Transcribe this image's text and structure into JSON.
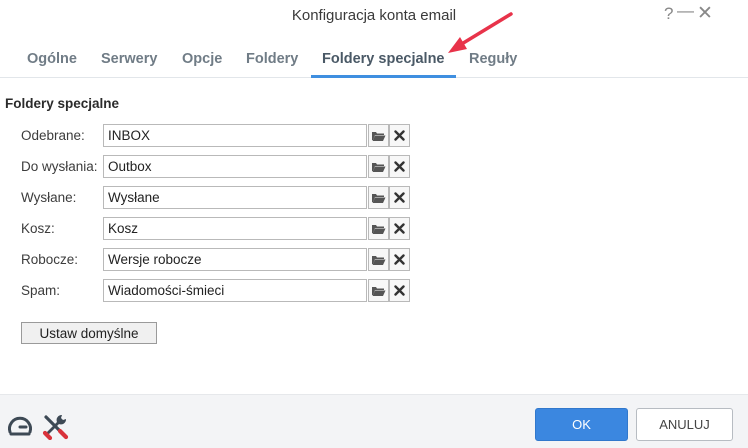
{
  "window": {
    "title": "Konfiguracja konta email",
    "help_label": "?",
    "minimize_label": "—",
    "close_label": "✕"
  },
  "tabs": [
    {
      "label": "Ogólne"
    },
    {
      "label": "Serwery"
    },
    {
      "label": "Opcje"
    },
    {
      "label": "Foldery"
    },
    {
      "label": "Foldery specjalne",
      "active": true
    },
    {
      "label": "Reguły"
    }
  ],
  "section": {
    "title": "Foldery specjalne"
  },
  "rows": [
    {
      "label": "Odebrane:",
      "value": "INBOX"
    },
    {
      "label": "Do wysłania:",
      "value": "Outbox"
    },
    {
      "label": "Wysłane:",
      "value": "Wysłane"
    },
    {
      "label": "Kosz:",
      "value": "Kosz"
    },
    {
      "label": "Robocze:",
      "value": "Wersje robocze"
    },
    {
      "label": "Spam:",
      "value": "Wiadomości-śmieci"
    }
  ],
  "buttons": {
    "set_default": "Ustaw domyślne",
    "ok": "OK",
    "cancel": "ANULUJ"
  },
  "icons": {
    "browse": "folder-open-icon",
    "clear": "close-x-icon",
    "footer_left": "dashboard-gauge-icon",
    "footer_right": "tools-icon"
  },
  "colors": {
    "accent": "#3b87e0",
    "annotation_arrow": "#e8334a"
  }
}
